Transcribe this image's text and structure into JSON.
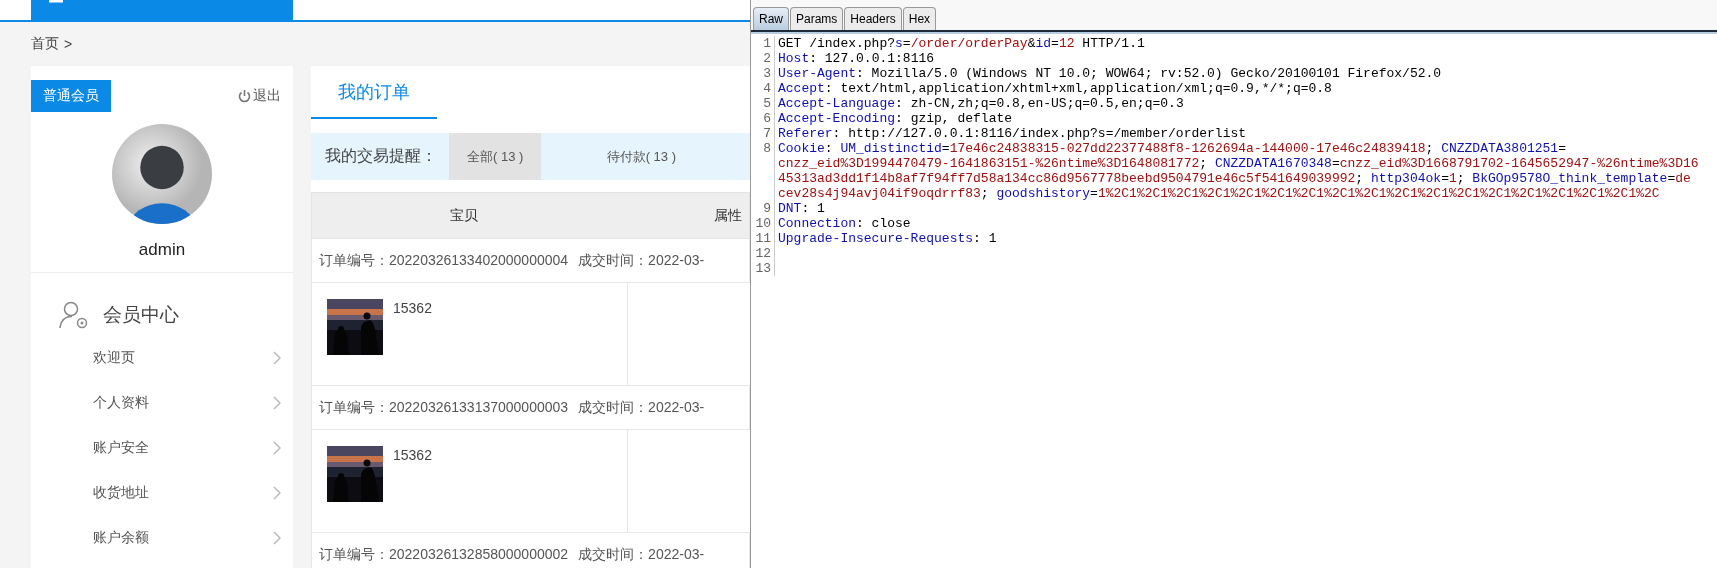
{
  "breadcrumb": {
    "home": "首页",
    "separator": ">"
  },
  "member": {
    "badge": "普通会员",
    "logout": "退出",
    "username": "admin"
  },
  "member_menu": {
    "title": "会员中心",
    "items": [
      "欢迎页",
      "个人资料",
      "账户安全",
      "收货地址",
      "账户余额"
    ]
  },
  "tabs": [
    {
      "label": "我的订单",
      "selected": true
    }
  ],
  "reminder": {
    "label": "我的交易提醒：",
    "filters": [
      {
        "label": "全部( 13 )",
        "selected": true
      },
      {
        "label": "待付款( 13 )",
        "selected": false
      }
    ]
  },
  "table": {
    "columns": [
      "宝贝",
      "属性"
    ],
    "orders": [
      {
        "order_no": "订单编号：20220326133402000000004",
        "deal_time": "成交时间：2022-03-",
        "product": {
          "title": "15362"
        }
      },
      {
        "order_no": "订单编号：20220326133137000000003",
        "deal_time": "成交时间：2022-03-",
        "product": {
          "title": "15362"
        }
      },
      {
        "order_no": "订单编号：20220326132858000000002",
        "deal_time": "成交时间：2022-03-"
      }
    ]
  },
  "request_editor": {
    "tabs": [
      {
        "label": "Raw",
        "selected": true
      },
      {
        "label": "Params",
        "selected": false
      },
      {
        "label": "Headers",
        "selected": false
      },
      {
        "label": "Hex",
        "selected": false
      }
    ],
    "lines": [
      {
        "number": "1",
        "rows": [
          {
            "segments": [
              {
                "kind": "plain",
                "text": "GET /index.php?"
              },
              {
                "kind": "name",
                "text": "s"
              },
              {
                "kind": "plain",
                "text": "="
              },
              {
                "kind": "value",
                "text": "/order/orderPay"
              },
              {
                "kind": "plain",
                "text": "&"
              },
              {
                "kind": "name",
                "text": "id"
              },
              {
                "kind": "plain",
                "text": "="
              },
              {
                "kind": "value",
                "text": "12"
              },
              {
                "kind": "plain",
                "text": " HTTP/1.1"
              }
            ]
          }
        ]
      },
      {
        "number": "2",
        "rows": [
          {
            "segments": [
              {
                "kind": "name",
                "text": "Host"
              },
              {
                "kind": "plain",
                "text": ": 127.0.0.1:8116"
              }
            ]
          }
        ]
      },
      {
        "number": "3",
        "rows": [
          {
            "segments": [
              {
                "kind": "name",
                "text": "User-Agent"
              },
              {
                "kind": "plain",
                "text": ": Mozilla/5.0 (Windows NT 10.0; WOW64; rv:52.0) Gecko/20100101 Firefox/52.0"
              }
            ]
          }
        ]
      },
      {
        "number": "4",
        "rows": [
          {
            "segments": [
              {
                "kind": "name",
                "text": "Accept"
              },
              {
                "kind": "plain",
                "text": ": text/html,application/xhtml+xml,application/xml;q=0.9,*/*;q=0.8"
              }
            ]
          }
        ]
      },
      {
        "number": "5",
        "rows": [
          {
            "segments": [
              {
                "kind": "name",
                "text": "Accept-Language"
              },
              {
                "kind": "plain",
                "text": ": zh-CN,zh;q=0.8,en-US;q=0.5,en;q=0.3"
              }
            ]
          }
        ]
      },
      {
        "number": "6",
        "rows": [
          {
            "segments": [
              {
                "kind": "name",
                "text": "Accept-Encoding"
              },
              {
                "kind": "plain",
                "text": ": gzip, deflate"
              }
            ]
          }
        ]
      },
      {
        "number": "7",
        "rows": [
          {
            "segments": [
              {
                "kind": "name",
                "text": "Referer"
              },
              {
                "kind": "plain",
                "text": ": http://127.0.0.1:8116/index.php?s=/member/orderlist"
              }
            ]
          }
        ]
      },
      {
        "number": "8",
        "rows": [
          {
            "segments": [
              {
                "kind": "name",
                "text": "Cookie"
              },
              {
                "kind": "plain",
                "text": ": "
              },
              {
                "kind": "name",
                "text": "UM_distinctid"
              },
              {
                "kind": "plain",
                "text": "="
              },
              {
                "kind": "value",
                "text": "17e46c24838315-027dd22377488f8-1262694a-144000-17e46c24839418"
              },
              {
                "kind": "plain",
                "text": "; "
              },
              {
                "kind": "name",
                "text": "CNZZDATA3801251"
              },
              {
                "kind": "plain",
                "text": "="
              }
            ]
          },
          {
            "segments": [
              {
                "kind": "value",
                "text": "cnzz_eid%3D1994470479-1641863151-%26ntime%3D1648081772"
              },
              {
                "kind": "plain",
                "text": "; "
              },
              {
                "kind": "name",
                "text": "CNZZDATA1670348"
              },
              {
                "kind": "plain",
                "text": "="
              },
              {
                "kind": "value",
                "text": "cnzz_eid%3D1668791702-1645652947-%26ntime%3D16"
              }
            ]
          },
          {
            "segments": [
              {
                "kind": "value",
                "text": "45313ad3dd1f14b8af7f94ff7d58a134cc86d9567778beebd9504791e46c5f541649039992"
              },
              {
                "kind": "plain",
                "text": "; "
              },
              {
                "kind": "name",
                "text": "http304ok"
              },
              {
                "kind": "plain",
                "text": "="
              },
              {
                "kind": "value",
                "text": "1"
              },
              {
                "kind": "plain",
                "text": "; "
              },
              {
                "kind": "name",
                "text": "BkGOp9578O_think_template"
              },
              {
                "kind": "plain",
                "text": "="
              },
              {
                "kind": "value",
                "text": "de"
              }
            ]
          },
          {
            "segments": [
              {
                "kind": "value",
                "text": "cev28s4j94avj04if9oqdrrf83"
              },
              {
                "kind": "plain",
                "text": "; "
              },
              {
                "kind": "name",
                "text": "goodshistory"
              },
              {
                "kind": "plain",
                "text": "="
              },
              {
                "kind": "value",
                "text": "1%2C1%2C1%2C1%2C1%2C1%2C1%2C1%2C1%2C1%2C1%2C1%2C1%2C1%2C1%2C1%2C1%2C1%2C"
              }
            ]
          }
        ]
      },
      {
        "number": "9",
        "rows": [
          {
            "segments": [
              {
                "kind": "name",
                "text": "DNT"
              },
              {
                "kind": "plain",
                "text": ": 1"
              }
            ]
          }
        ]
      },
      {
        "number": "10",
        "rows": [
          {
            "segments": [
              {
                "kind": "name",
                "text": "Connection"
              },
              {
                "kind": "plain",
                "text": ": close"
              }
            ]
          }
        ]
      },
      {
        "number": "11",
        "rows": [
          {
            "segments": [
              {
                "kind": "name",
                "text": "Upgrade-Insecure-Requests"
              },
              {
                "kind": "plain",
                "text": ": 1"
              }
            ]
          }
        ]
      },
      {
        "number": "12"
      },
      {
        "number": "13"
      }
    ]
  }
}
